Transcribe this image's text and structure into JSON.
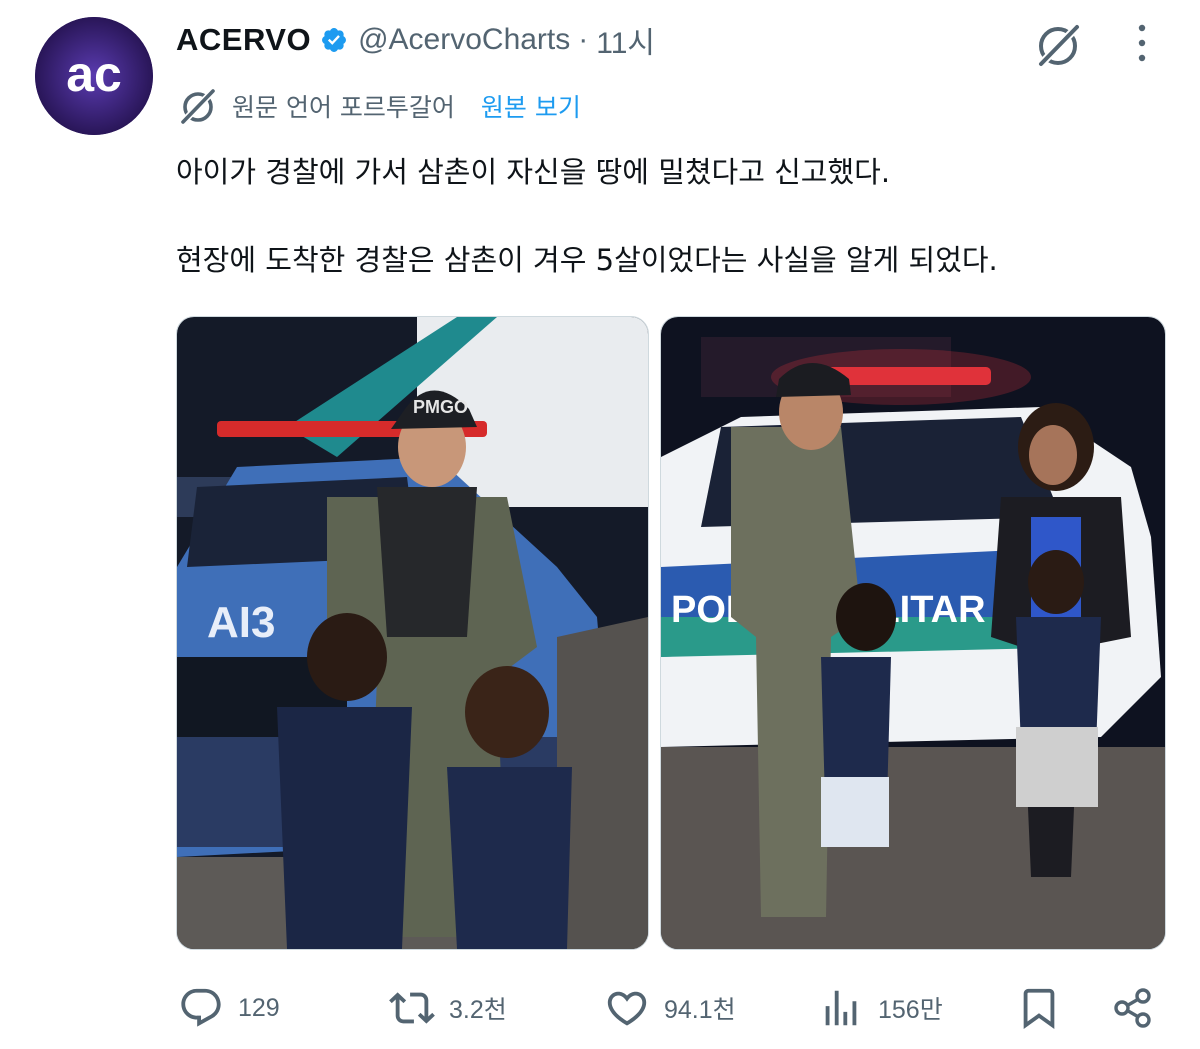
{
  "author": {
    "display_name": "ACERVO",
    "handle": "@AcervoCharts",
    "separator": "·",
    "time": "11시",
    "avatar_text": "ac",
    "verified": true
  },
  "translation": {
    "label": "원문 언어 포르투갈어",
    "show_original": "원본 보기"
  },
  "tweet": {
    "line1": "아이가 경찰에 가서 삼촌이 자신을 땅에 밀쳤다고 신고했다.",
    "line2": "현장에 도착한 경찰은 삼촌이 겨우 5살이었다는 사실을 알게 되었다."
  },
  "media": {
    "photo1_cap_text": "PMGO",
    "photo1_car_text": "AI3",
    "photo2_car_text": "POLÍCIA MILITAR"
  },
  "actions": {
    "replies": "129",
    "reposts": "3.2천",
    "likes": "94.1천",
    "views": "156만"
  },
  "colors": {
    "text_primary": "#0f1419",
    "text_secondary": "#536471",
    "link": "#1d9bf0",
    "verified_badge": "#1d9bf0",
    "avatar_bg": "#2b1760"
  },
  "icons": {
    "verified": "verified-badge-icon",
    "grok": "grok-icon",
    "more": "more-icon",
    "translate": "translate-icon",
    "reply": "reply-icon",
    "repost": "repost-icon",
    "like": "heart-icon",
    "views": "views-icon",
    "bookmark": "bookmark-icon",
    "share": "share-icon"
  }
}
